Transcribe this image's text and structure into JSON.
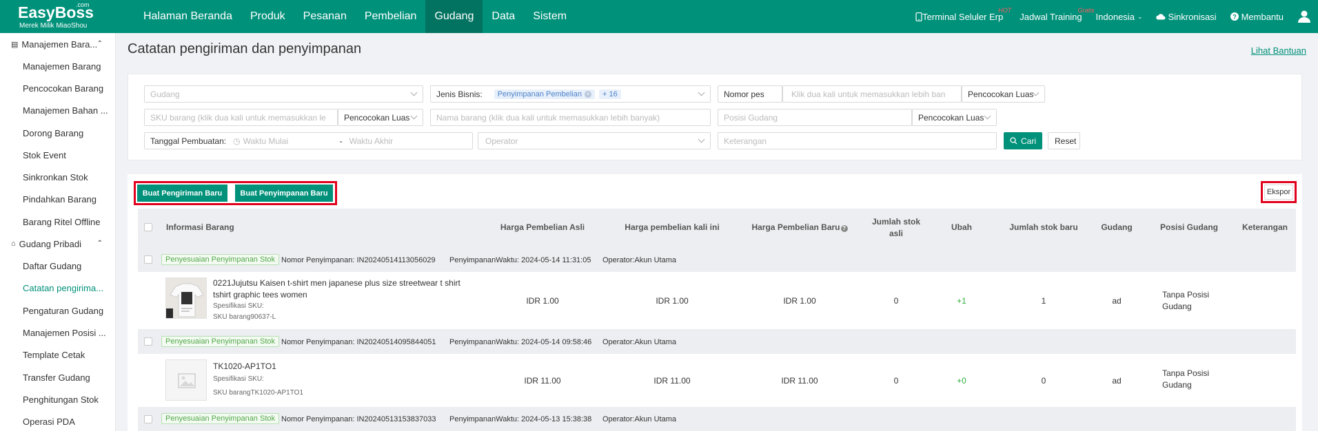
{
  "brand": {
    "name": "EasyBoss",
    "com": ".com",
    "tagline": "Merek Milik MiaoShou"
  },
  "nav": {
    "menu": [
      "Halaman Beranda",
      "Produk",
      "Pesanan",
      "Pembelian",
      "Gudang",
      "Data",
      "Sistem"
    ],
    "active": "Gudang",
    "right": {
      "terminal": "Terminal Seluler Erp",
      "terminal_badge": "HOT",
      "training": "Jadwal Training",
      "training_badge": "Gratis",
      "language": "Indonesia",
      "sync": "Sinkronisasi",
      "help": "Membantu"
    }
  },
  "sidebar": {
    "group1": "Manajemen Bara...",
    "group1_items": [
      "Manajemen Barang",
      "Pencocokan Barang",
      "Manajemen Bahan ...",
      "Dorong Barang",
      "Stok Event",
      "Sinkronkan Stok",
      "Pindahkan Barang",
      "Barang Ritel Offline"
    ],
    "group2": "Gudang Pribadi",
    "group2_items": [
      "Daftar Gudang",
      "Catatan pengirima...",
      "Pengaturan Gudang",
      "Manajemen Posisi ...",
      "Template Cetak",
      "Transfer Gudang",
      "Penghitungan Stok",
      "Operasi PDA"
    ],
    "active_item": "Catatan pengirima..."
  },
  "page": {
    "title": "Catatan pengiriman dan penyimpanan",
    "help_link": "Lihat Bantuan"
  },
  "filters": {
    "gudang": "Gudang",
    "jenis_label": "Jenis Bisnis:",
    "jenis_chip": "Penyimpanan Pembelian",
    "jenis_more": "+ 16",
    "nomor_select": "Nomor pes",
    "nomor_placeholder": "Klik dua kali untuk memasukkan lebih ban",
    "match1": "Pencocokan Luas",
    "sku_placeholder": "SKU barang (klik dua kali untuk memasukkan le",
    "match2": "Pencocokan Luas",
    "nama_placeholder": "Nama barang (klik dua kali untuk memasukkan lebih banyak)",
    "posisi_placeholder": "Posisi Gudang",
    "match3": "Pencocokan Luas",
    "tanggal_label": "Tanggal Pembuatan:",
    "start": "Waktu Mulai",
    "dash": "-",
    "end": "Waktu Akhir",
    "operator": "Operator",
    "keterangan": "Keterangan",
    "search_btn": "Cari",
    "reset_btn": "Reset"
  },
  "actions": {
    "new_out": "Buat Pengiriman Baru",
    "new_in": "Buat Penyimpanan Baru",
    "export": "Ekspor"
  },
  "table": {
    "headers": {
      "info": "Informasi Barang",
      "harga_asli": "Harga Pembelian Asli",
      "harga_kali": "Harga pembelian kali ini",
      "harga_baru": "Harga Pembelian Baru",
      "stok_asli": "Jumlah stok asli",
      "ubah": "Ubah",
      "stok_baru": "Jumlah stok baru",
      "gudang": "Gudang",
      "posisi": "Posisi Gudang",
      "keterangan": "Keterangan"
    },
    "records": [
      {
        "badge": "Penyesuaian Penyimpanan Stok",
        "nomor": "Nomor Penyimpanan: IN20240514113056029",
        "waktu": "PenyimpananWaktu: 2024-05-14 11:31:05",
        "operator": "Operator:Akun Utama",
        "name": "0221Jujutsu Kaisen t-shirt men japanese plus size streetwear t shirt tshirt graphic tees women",
        "spec": "Spesifikasi SKU:",
        "sku": "SKU barang90637-L",
        "harga_asli": "IDR 1.00",
        "harga_kali": "IDR 1.00",
        "harga_baru": "IDR 1.00",
        "stok_asli": "0",
        "ubah": "+1",
        "stok_baru": "1",
        "gudang": "ad",
        "posisi": "Tanpa Posisi Gudang",
        "image": "photo"
      },
      {
        "badge": "Penyesuaian Penyimpanan Stok",
        "nomor": "Nomor Penyimpanan: IN20240514095844051",
        "waktu": "PenyimpananWaktu: 2024-05-14 09:58:46",
        "operator": "Operator:Akun Utama",
        "name": "TK1020-AP1TO1",
        "spec": "Spesifikasi SKU:",
        "sku": "SKU barangTK1020-AP1TO1",
        "harga_asli": "IDR 11.00",
        "harga_kali": "IDR 11.00",
        "harga_baru": "IDR 11.00",
        "stok_asli": "0",
        "ubah": "+0",
        "stok_baru": "0",
        "gudang": "ad",
        "posisi": "Tanpa Posisi Gudang",
        "image": "placeholder"
      },
      {
        "badge": "Penyesuaian Penyimpanan Stok",
        "nomor": "Nomor Penyimpanan: IN20240513153837033",
        "waktu": "PenyimpananWaktu: 2024-05-13 15:38:38",
        "operator": "Operator:Akun Utama"
      }
    ]
  },
  "colors": {
    "primary": "#00917a",
    "highlight": "#e0001b"
  }
}
